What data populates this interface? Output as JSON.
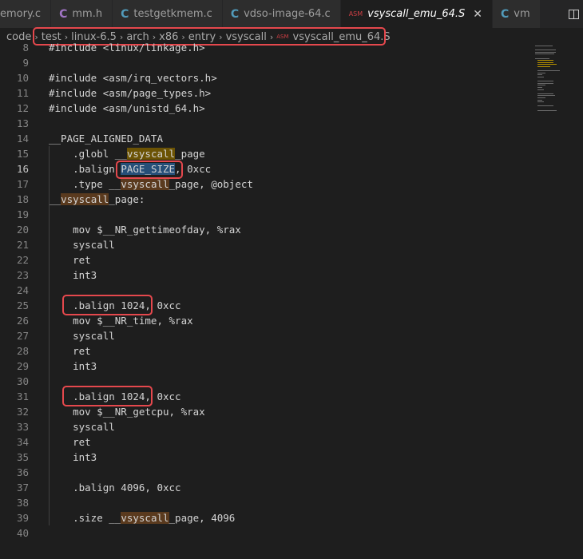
{
  "tabs": [
    {
      "label": "emory.c",
      "icon": "c-file-icon",
      "active": false
    },
    {
      "label": "mm.h",
      "icon": "c-header-icon",
      "active": false
    },
    {
      "label": "testgetkmem.c",
      "icon": "c-file-icon",
      "active": false
    },
    {
      "label": "vdso-image-64.c",
      "icon": "c-file-icon",
      "active": false
    },
    {
      "label": "vsyscall_emu_64.S",
      "icon": "asm-file-icon",
      "active": true
    },
    {
      "label": "vm",
      "icon": "c-file-icon",
      "active": false
    }
  ],
  "tab_icon_glyphs": {
    "c": "C",
    "asm": "ASM",
    "close": "✕"
  },
  "breadcrumbs": [
    "code",
    "test",
    "linux-6.5",
    "arch",
    "x86",
    "entry",
    "vsyscall",
    "vsyscall_emu_64.S"
  ],
  "breadcrumb_separator": "›",
  "current_line": 16,
  "lines": [
    {
      "n": "8",
      "text": "#include <linux/linkage.h>"
    },
    {
      "n": "9",
      "text": ""
    },
    {
      "n": "10",
      "text": "#include <asm/irq_vectors.h>"
    },
    {
      "n": "11",
      "text": "#include <asm/page_types.h>"
    },
    {
      "n": "12",
      "text": "#include <asm/unistd_64.h>"
    },
    {
      "n": "13",
      "text": ""
    },
    {
      "n": "14",
      "text": "__PAGE_ALIGNED_DATA"
    },
    {
      "n": "15",
      "pre": "    .globl __",
      "mid": "vsyscall",
      "post": "_page"
    },
    {
      "n": "16",
      "pre": "    .balign ",
      "mid": "PAGE_SIZE",
      "post": ", 0xcc"
    },
    {
      "n": "17",
      "pre": "    .type __",
      "mid": "vsyscall",
      "post": "_page, @object"
    },
    {
      "n": "18",
      "pre": "__",
      "mid": "vsyscall",
      "post": "_page:"
    },
    {
      "n": "19",
      "text": ""
    },
    {
      "n": "20",
      "text": "    mov $__NR_gettimeofday, %rax"
    },
    {
      "n": "21",
      "text": "    syscall"
    },
    {
      "n": "22",
      "text": "    ret"
    },
    {
      "n": "23",
      "text": "    int3"
    },
    {
      "n": "24",
      "text": ""
    },
    {
      "n": "25",
      "text": "    .balign 1024, 0xcc"
    },
    {
      "n": "26",
      "text": "    mov $__NR_time, %rax"
    },
    {
      "n": "27",
      "text": "    syscall"
    },
    {
      "n": "28",
      "text": "    ret"
    },
    {
      "n": "29",
      "text": "    int3"
    },
    {
      "n": "30",
      "text": ""
    },
    {
      "n": "31",
      "text": "    .balign 1024, 0xcc"
    },
    {
      "n": "32",
      "text": "    mov $__NR_getcpu, %rax"
    },
    {
      "n": "33",
      "text": "    syscall"
    },
    {
      "n": "34",
      "text": "    ret"
    },
    {
      "n": "35",
      "text": "    int3"
    },
    {
      "n": "36",
      "text": ""
    },
    {
      "n": "37",
      "text": "    .balign 4096, 0xcc"
    },
    {
      "n": "38",
      "text": ""
    },
    {
      "n": "39",
      "pre": "    .size __",
      "mid": "vsyscall",
      "post": "_page, 4096"
    },
    {
      "n": "40",
      "text": ""
    }
  ],
  "colors": {
    "background": "#1e1e1e",
    "highlight_yellow": "#6b5304",
    "highlight_brown": "#5a3a1e",
    "selection": "#264f78",
    "annotation_red": "#e5484d"
  }
}
